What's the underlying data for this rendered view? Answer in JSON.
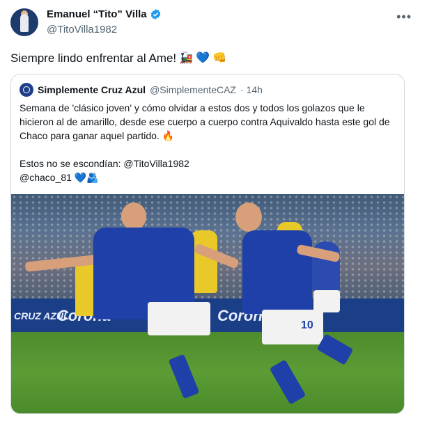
{
  "author": {
    "name": "Emanuel “Tito” Villa",
    "handle": "@TitoVilla1982",
    "verified": true,
    "verified_color": "#1d9bf0"
  },
  "tweet": {
    "text": "Siempre lindo enfrentar al Ame!",
    "emojis": [
      "🚂",
      "💙",
      "👊"
    ]
  },
  "quoted": {
    "name": "Simplemente Cruz Azul",
    "handle": "@SimplementeCAZ",
    "time": "· 14h",
    "text1": "Semana de 'clásico joven' y cómo olvidar a estos dos y todos los golazos que le hicieron al de amarillo, desde ese cuerpo a cuerpo contra Aquivaldo hasta este gol de Chaco para ganar aquel partido. 🔥",
    "text2": "Estos no se escondían: @TitoVilla1982",
    "text3": "@chaco_81 💙🫂",
    "image": {
      "boards": [
        "CRUZ AZUL",
        "Corona",
        "Coron"
      ],
      "jersey_number": "10"
    }
  },
  "icons": {
    "more": "more-icon",
    "verified": "verified-badge-icon"
  }
}
